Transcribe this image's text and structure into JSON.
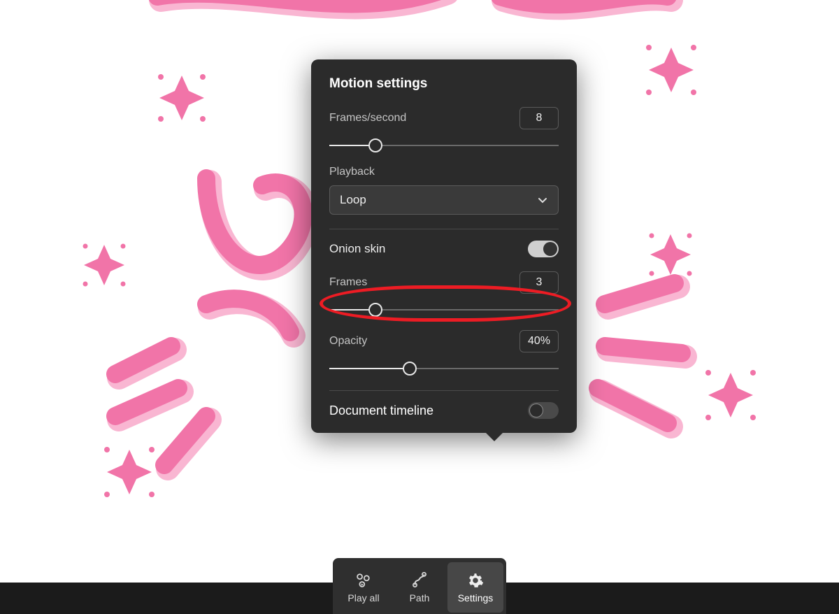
{
  "panel": {
    "title": "Motion settings",
    "fps": {
      "label": "Frames/second",
      "value": "8",
      "sliderPct": 20
    },
    "playback": {
      "label": "Playback",
      "value": "Loop"
    },
    "onion": {
      "label": "Onion skin",
      "on": true
    },
    "frames": {
      "label": "Frames",
      "value": "3",
      "sliderPct": 20
    },
    "opacity": {
      "label": "Opacity",
      "value": "40%",
      "sliderPct": 35
    },
    "docTimeline": {
      "label": "Document timeline",
      "on": false
    }
  },
  "toolbar": {
    "playAll": "Play all",
    "path": "Path",
    "settings": "Settings"
  }
}
